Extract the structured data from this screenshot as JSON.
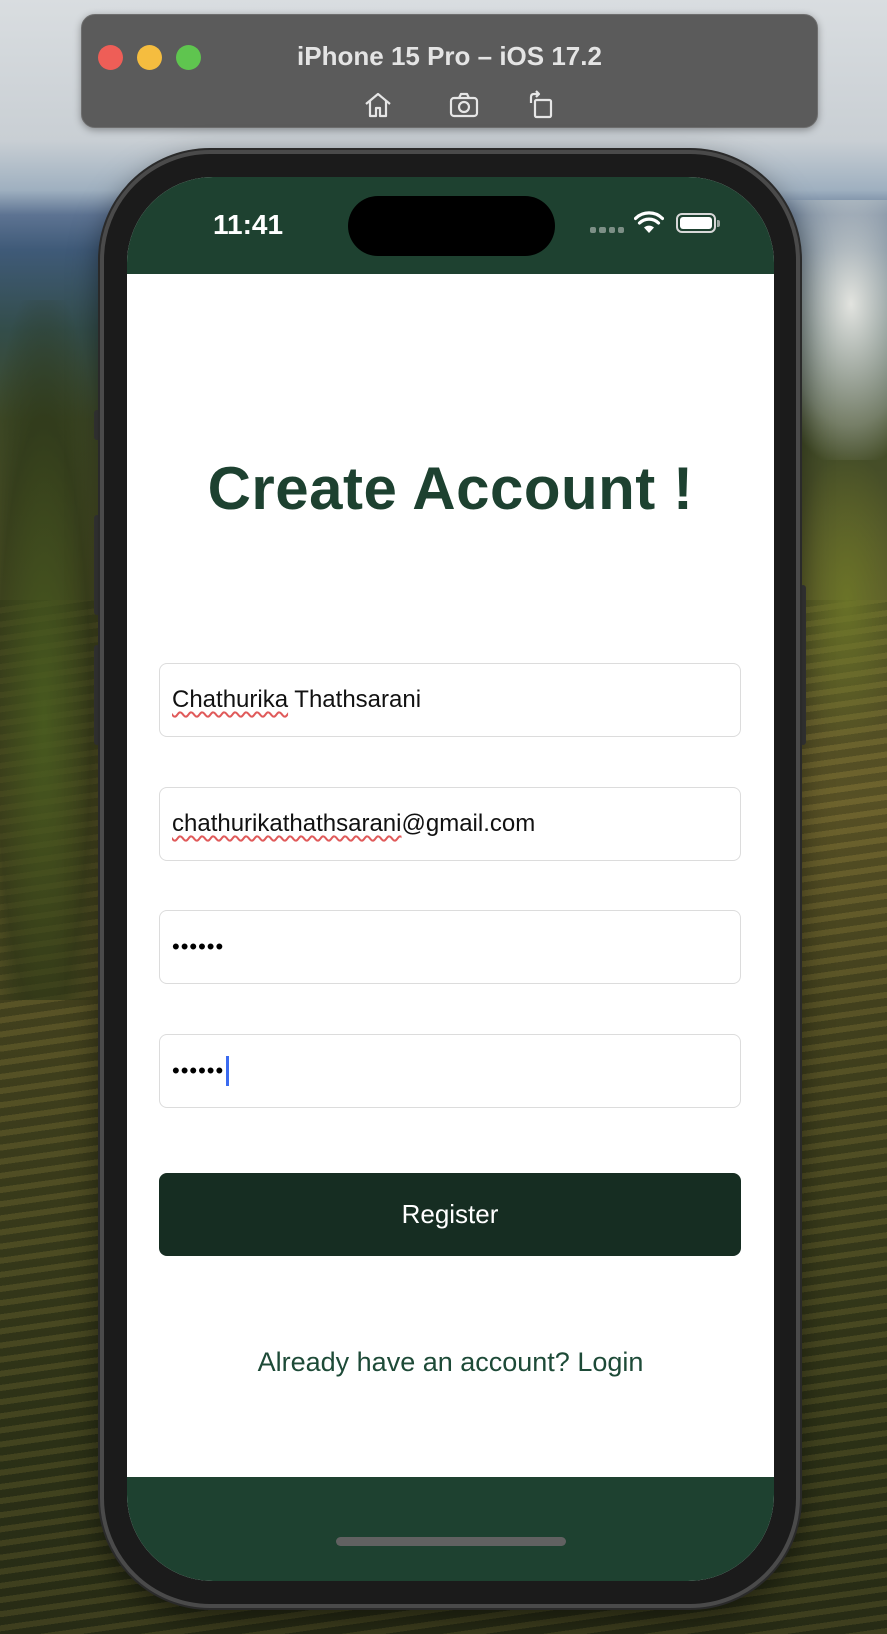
{
  "simulator": {
    "title": "iPhone 15 Pro – iOS 17.2",
    "toolbar": [
      "home-icon",
      "screenshot-icon",
      "rotate-icon"
    ]
  },
  "status_bar": {
    "time": "11:41"
  },
  "colors": {
    "primary": "#1e4130",
    "button": "#162d22",
    "heading": "#1d4130"
  },
  "form": {
    "heading": "Create Account !",
    "name_first": "Chathurika",
    "name_rest": " Thathsarani",
    "email_user": "chathurikathathsarani",
    "email_domain": "@gmail.com",
    "password": "••••••",
    "confirm_password": "••••••",
    "register_label": "Register",
    "login_prompt": "Already have an account? Login"
  }
}
